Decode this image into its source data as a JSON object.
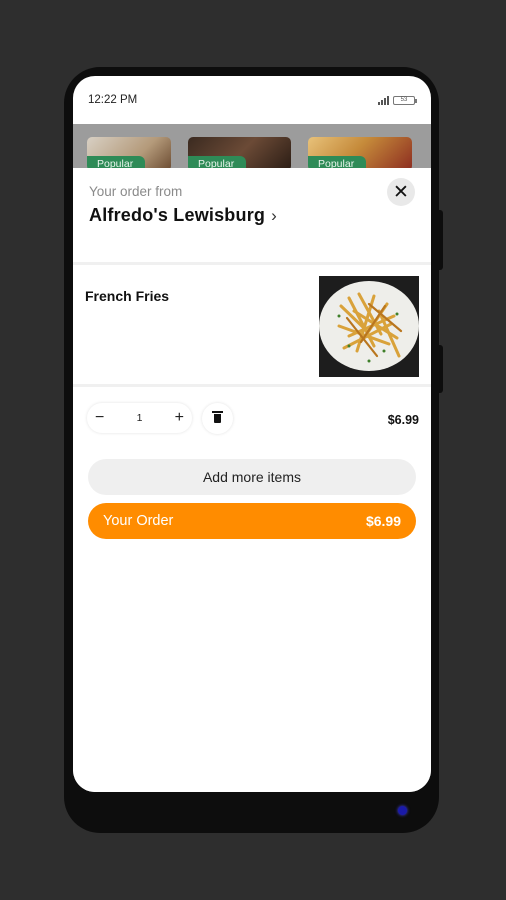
{
  "status_bar": {
    "time": "12:22 PM",
    "battery": "53"
  },
  "background_cards": [
    {
      "badge": "Popular"
    },
    {
      "badge": "Popular"
    },
    {
      "badge": "Popular"
    }
  ],
  "header": {
    "order_from_label": "Your order from",
    "restaurant_name": "Alfredo's Lewisburg",
    "restaurant_chevron": "›",
    "close_icon": "✕"
  },
  "item": {
    "name": "French Fries",
    "quantity": "1",
    "decrement": "−",
    "increment": "+",
    "price": "$6.99",
    "image_icon": "french-fries-photo"
  },
  "actions": {
    "add_more_label": "Add more items",
    "your_order_label": "Your Order",
    "your_order_total": "$6.99"
  },
  "colors": {
    "accent": "#ff8c00",
    "badge": "#2e8b57",
    "background": "#2e2e2e"
  }
}
